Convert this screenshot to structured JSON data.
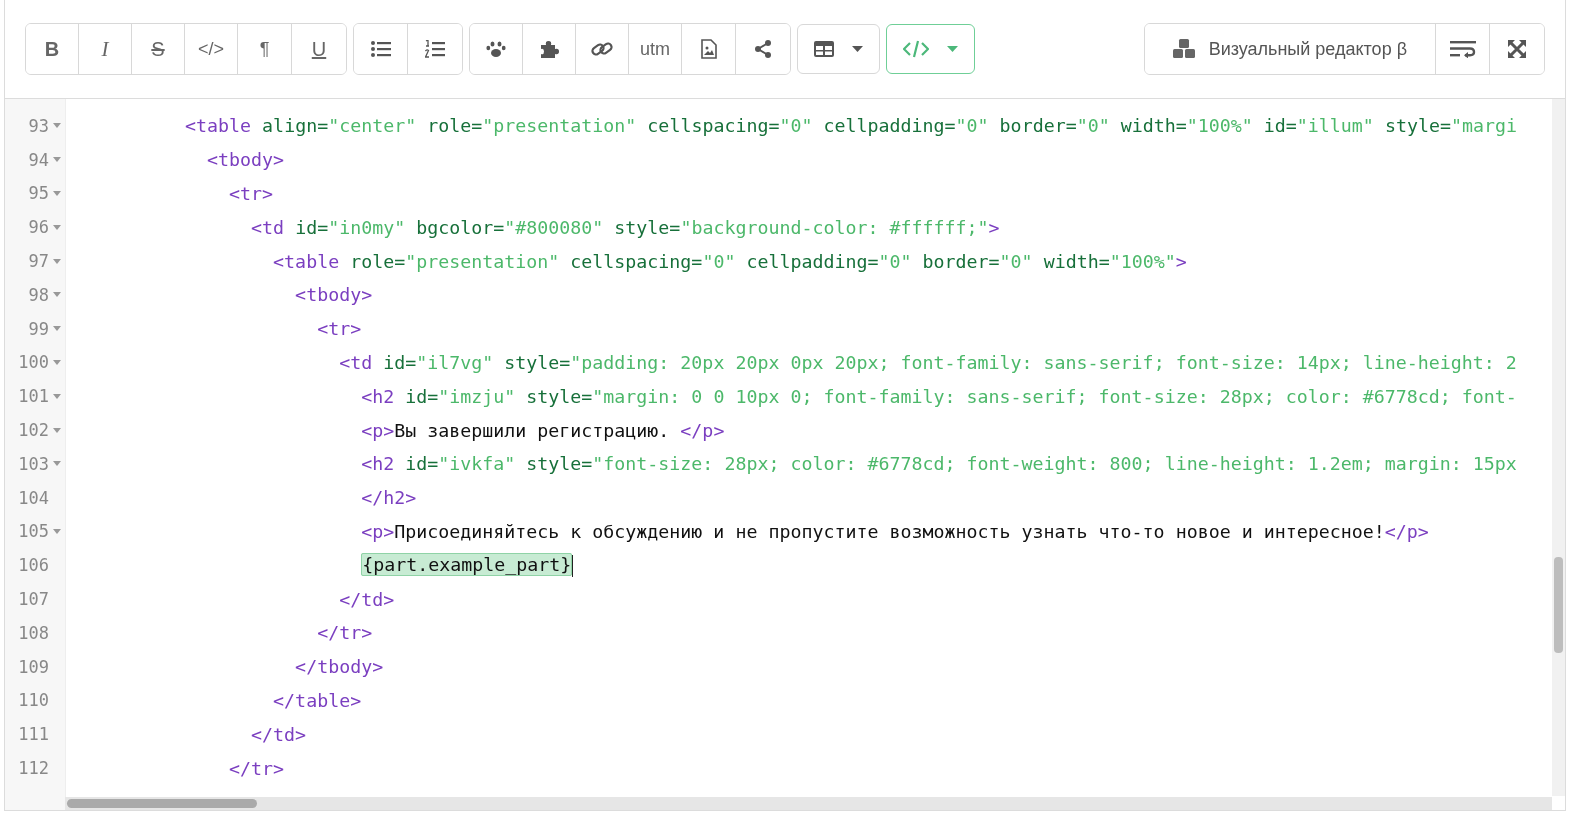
{
  "toolbar": {
    "groups": [
      {
        "buttons": [
          {
            "kind": "bold",
            "label": "B"
          },
          {
            "kind": "italic",
            "label": "I"
          },
          {
            "kind": "strike",
            "label": "S"
          },
          {
            "kind": "text",
            "label": "</>"
          },
          {
            "kind": "text",
            "label": "¶"
          },
          {
            "kind": "underline",
            "label": "U"
          }
        ]
      },
      {
        "buttons": [
          {
            "kind": "bullets"
          },
          {
            "kind": "numbers"
          }
        ]
      },
      {
        "buttons": [
          {
            "kind": "paw"
          },
          {
            "kind": "puzzle"
          },
          {
            "kind": "link"
          },
          {
            "kind": "text",
            "label": "utm"
          },
          {
            "kind": "image"
          },
          {
            "kind": "share"
          }
        ]
      }
    ],
    "dropdowns": [
      {
        "kind": "table",
        "selected": false
      },
      {
        "kind": "code",
        "selected": true
      }
    ],
    "visual_editor": {
      "label": "Визуальный редактор β"
    },
    "right_buttons": [
      {
        "kind": "wrap"
      },
      {
        "kind": "expand"
      }
    ]
  },
  "editor": {
    "lines": [
      {
        "number": "93",
        "foldable": true,
        "tokens": [
          {
            "kind": "tag",
            "text": "          <table"
          },
          {
            "kind": "attr",
            "text": " align="
          },
          {
            "kind": "str",
            "text": "\"center\""
          },
          {
            "kind": "attr",
            "text": " role="
          },
          {
            "kind": "str",
            "text": "\"presentation\""
          },
          {
            "kind": "attr",
            "text": " cellspacing="
          },
          {
            "kind": "str",
            "text": "\"0\""
          },
          {
            "kind": "attr",
            "text": " cellpadding="
          },
          {
            "kind": "str",
            "text": "\"0\""
          },
          {
            "kind": "attr",
            "text": " border="
          },
          {
            "kind": "str",
            "text": "\"0\""
          },
          {
            "kind": "attr",
            "text": " width="
          },
          {
            "kind": "str",
            "text": "\"100%\""
          },
          {
            "kind": "attr",
            "text": " id="
          },
          {
            "kind": "str",
            "text": "\"illum\""
          },
          {
            "kind": "attr",
            "text": " style="
          },
          {
            "kind": "str",
            "text": "\"margi"
          }
        ]
      },
      {
        "number": "94",
        "foldable": true,
        "tokens": [
          {
            "kind": "tag",
            "text": "            <tbody>"
          }
        ]
      },
      {
        "number": "95",
        "foldable": true,
        "tokens": [
          {
            "kind": "tag",
            "text": "              <tr>"
          }
        ]
      },
      {
        "number": "96",
        "foldable": true,
        "tokens": [
          {
            "kind": "tag",
            "text": "                <td"
          },
          {
            "kind": "attr",
            "text": " id="
          },
          {
            "kind": "str",
            "text": "\"in0my\""
          },
          {
            "kind": "attr",
            "text": " bgcolor="
          },
          {
            "kind": "str",
            "text": "\"#800080\""
          },
          {
            "kind": "attr",
            "text": " style="
          },
          {
            "kind": "str",
            "text": "\"background-color: #ffffff;\""
          },
          {
            "kind": "tag",
            "text": ">"
          }
        ]
      },
      {
        "number": "97",
        "foldable": true,
        "tokens": [
          {
            "kind": "tag",
            "text": "                  <table"
          },
          {
            "kind": "attr",
            "text": " role="
          },
          {
            "kind": "str",
            "text": "\"presentation\""
          },
          {
            "kind": "attr",
            "text": " cellspacing="
          },
          {
            "kind": "str",
            "text": "\"0\""
          },
          {
            "kind": "attr",
            "text": " cellpadding="
          },
          {
            "kind": "str",
            "text": "\"0\""
          },
          {
            "kind": "attr",
            "text": " border="
          },
          {
            "kind": "str",
            "text": "\"0\""
          },
          {
            "kind": "attr",
            "text": " width="
          },
          {
            "kind": "str",
            "text": "\"100%\""
          },
          {
            "kind": "tag",
            "text": ">"
          }
        ]
      },
      {
        "number": "98",
        "foldable": true,
        "tokens": [
          {
            "kind": "tag",
            "text": "                    <tbody>"
          }
        ]
      },
      {
        "number": "99",
        "foldable": true,
        "tokens": [
          {
            "kind": "tag",
            "text": "                      <tr>"
          }
        ]
      },
      {
        "number": "100",
        "foldable": true,
        "tokens": [
          {
            "kind": "tag",
            "text": "                        <td"
          },
          {
            "kind": "attr",
            "text": " id="
          },
          {
            "kind": "str",
            "text": "\"il7vg\""
          },
          {
            "kind": "attr",
            "text": " style="
          },
          {
            "kind": "str",
            "text": "\"padding: 20px 20px 0px 20px; font-family: sans-serif; font-size: 14px; line-height: 2"
          }
        ]
      },
      {
        "number": "101",
        "foldable": true,
        "tokens": [
          {
            "kind": "tag",
            "text": "                          <h2"
          },
          {
            "kind": "attr",
            "text": " id="
          },
          {
            "kind": "str",
            "text": "\"imzju\""
          },
          {
            "kind": "attr",
            "text": " style="
          },
          {
            "kind": "str",
            "text": "\"margin: 0 0 10px 0; font-family: sans-serif; font-size: 28px; color: #6778cd; font-"
          }
        ]
      },
      {
        "number": "102",
        "foldable": true,
        "tokens": [
          {
            "kind": "tag",
            "text": "                          <p>"
          },
          {
            "kind": "plain",
            "text": "Вы завершили регистрацию. "
          },
          {
            "kind": "tag",
            "text": "</p>"
          }
        ]
      },
      {
        "number": "103",
        "foldable": true,
        "tokens": [
          {
            "kind": "tag",
            "text": "                          <h2"
          },
          {
            "kind": "attr",
            "text": " id="
          },
          {
            "kind": "str",
            "text": "\"ivkfa\""
          },
          {
            "kind": "attr",
            "text": " style="
          },
          {
            "kind": "str",
            "text": "\"font-size: 28px; color: #6778cd; font-weight: 800; line-height: 1.2em; margin: 15px"
          }
        ]
      },
      {
        "number": "104",
        "foldable": false,
        "tokens": [
          {
            "kind": "tag",
            "text": "                          </h2>"
          }
        ]
      },
      {
        "number": "105",
        "foldable": true,
        "tokens": [
          {
            "kind": "tag",
            "text": "                          <p>"
          },
          {
            "kind": "plain",
            "text": "Присоединяйтесь к обсуждению и не пропустите возможность узнать что-то новое и интересное!"
          },
          {
            "kind": "tag",
            "text": "</p>"
          }
        ]
      },
      {
        "number": "106",
        "foldable": false,
        "cursor": true,
        "tokens": [
          {
            "kind": "indent-mark",
            "text": "                          {part.example_part}"
          }
        ]
      },
      {
        "number": "107",
        "foldable": false,
        "tokens": [
          {
            "kind": "tag",
            "text": "                        </td>"
          }
        ]
      },
      {
        "number": "108",
        "foldable": false,
        "tokens": [
          {
            "kind": "tag",
            "text": "                      </tr>"
          }
        ]
      },
      {
        "number": "109",
        "foldable": false,
        "tokens": [
          {
            "kind": "tag",
            "text": "                    </tbody>"
          }
        ]
      },
      {
        "number": "110",
        "foldable": false,
        "tokens": [
          {
            "kind": "tag",
            "text": "                  </table>"
          }
        ]
      },
      {
        "number": "111",
        "foldable": false,
        "tokens": [
          {
            "kind": "tag",
            "text": "                </td>"
          }
        ]
      },
      {
        "number": "112",
        "foldable": false,
        "tokens": [
          {
            "kind": "tag",
            "text": "              </tr>"
          }
        ]
      }
    ]
  }
}
